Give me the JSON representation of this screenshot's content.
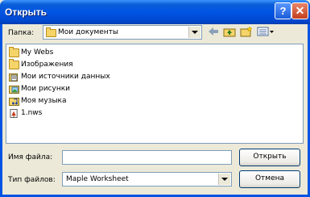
{
  "window": {
    "title": "Открыть"
  },
  "titlebar": {
    "help_glyph": "?",
    "close_glyph": "✕"
  },
  "toolbar": {
    "folder_label": "Папка:",
    "folder_value": "Мои документы",
    "icons": [
      "back-arrow-icon",
      "up-folder-icon",
      "new-folder-icon",
      "view-menu-icon"
    ]
  },
  "files": [
    {
      "name": "My Webs",
      "icon": "folder-icon"
    },
    {
      "name": "Изображения",
      "icon": "folder-icon"
    },
    {
      "name": "Мои источники данных",
      "icon": "data-sources-icon"
    },
    {
      "name": "Мои рисунки",
      "icon": "pictures-folder-icon"
    },
    {
      "name": "Моя музыка",
      "icon": "music-folder-icon"
    },
    {
      "name": "1.nws",
      "icon": "maple-file-icon"
    }
  ],
  "filename": {
    "label": "Имя файла:",
    "value": ""
  },
  "filetype": {
    "label": "Тип файлов:",
    "value": "Maple Worksheet"
  },
  "buttons": {
    "open": "Открыть",
    "cancel": "Отмена"
  }
}
